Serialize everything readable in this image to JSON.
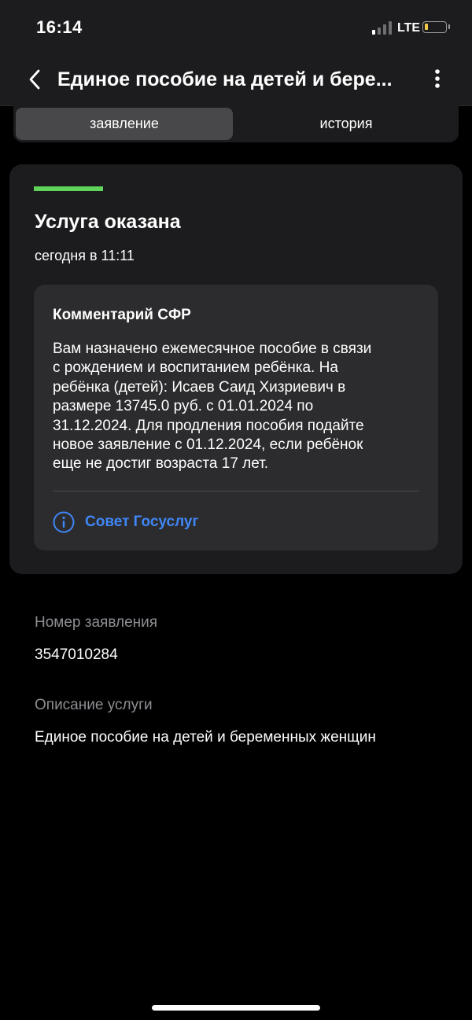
{
  "status_bar": {
    "time": "16:14",
    "network": "LTE",
    "battery_color": "#f7c948"
  },
  "header": {
    "title": "Единое пособие на детей и бере...",
    "back_icon": "chevron-left-icon",
    "menu_icon": "more-vertical-icon"
  },
  "tabs": [
    {
      "label": "заявление",
      "active": true
    },
    {
      "label": "история",
      "active": false
    }
  ],
  "status_card": {
    "stripe_color": "#5fd35a",
    "title": "Услуга оказана",
    "time": "сегодня в 11:11",
    "comment": {
      "heading": "Комментарий СФР",
      "lines": [
        "Вам назначено ежемесячное пособие в связи",
        "с рождением и воспитанием ребёнка. На",
        "ребёнка (детей): Исаев Саид Хизриевич в",
        "размере 13745.0 руб. с 01.01.2024 по",
        "31.12.2024. Для продления пособия подайте",
        "новое заявление с 01.12.2024, если ребёнок",
        "еще не достиг возраста 17 лет."
      ],
      "advice_label": "Совет Госуслуг",
      "advice_icon": "info-icon",
      "link_color": "#3f86f6"
    }
  },
  "details": {
    "application_number_label": "Номер заявления",
    "application_number": "3547010284",
    "service_description_label": "Описание услуги",
    "service_description": "Единое пособие на детей и беременных женщин"
  }
}
